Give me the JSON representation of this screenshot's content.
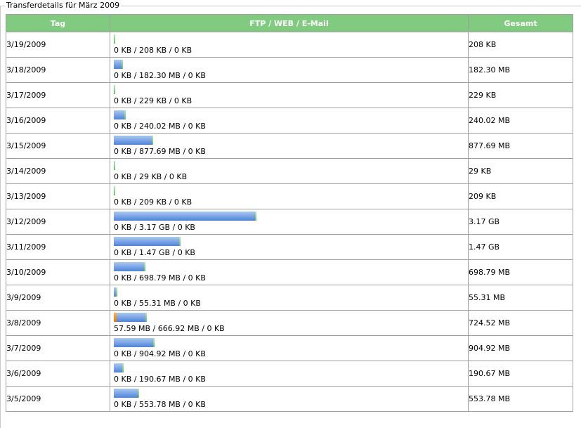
{
  "legend": "Transferdetails für März 2009",
  "headers": {
    "day": "Tag",
    "transfer": "FTP / WEB / E-Mail",
    "total": "Gesamt"
  },
  "colors": {
    "header_bg": "#81cb81",
    "ftp": "#f09a2a",
    "web": "#6b98e0",
    "mail": "#7fd07f"
  },
  "rows": [
    {
      "day": "3/19/2009",
      "detail": "0 KB / 208 KB / 0 KB",
      "total": "208 KB",
      "ftp_gb": 0,
      "web_gb": 0.0002
    },
    {
      "day": "3/18/2009",
      "detail": "0 KB / 182.30 MB / 0 KB",
      "total": "182.30 MB",
      "ftp_gb": 0,
      "web_gb": 0.178
    },
    {
      "day": "3/17/2009",
      "detail": "0 KB / 229 KB / 0 KB",
      "total": "229 KB",
      "ftp_gb": 0,
      "web_gb": 0.0002
    },
    {
      "day": "3/16/2009",
      "detail": "0 KB / 240.02 MB / 0 KB",
      "total": "240.02 MB",
      "ftp_gb": 0,
      "web_gb": 0.2344
    },
    {
      "day": "3/15/2009",
      "detail": "0 KB / 877.69 MB / 0 KB",
      "total": "877.69 MB",
      "ftp_gb": 0,
      "web_gb": 0.8571
    },
    {
      "day": "3/14/2009",
      "detail": "0 KB / 29 KB / 0 KB",
      "total": "29 KB",
      "ftp_gb": 0,
      "web_gb": 3e-05
    },
    {
      "day": "3/13/2009",
      "detail": "0 KB / 209 KB / 0 KB",
      "total": "209 KB",
      "ftp_gb": 0,
      "web_gb": 0.0002
    },
    {
      "day": "3/12/2009",
      "detail": "0 KB / 3.17 GB / 0 KB",
      "total": "3.17 GB",
      "ftp_gb": 0,
      "web_gb": 3.17
    },
    {
      "day": "3/11/2009",
      "detail": "0 KB / 1.47 GB / 0 KB",
      "total": "1.47 GB",
      "ftp_gb": 0,
      "web_gb": 1.47
    },
    {
      "day": "3/10/2009",
      "detail": "0 KB / 698.79 MB / 0 KB",
      "total": "698.79 MB",
      "ftp_gb": 0,
      "web_gb": 0.6824
    },
    {
      "day": "3/9/2009",
      "detail": "0 KB / 55.31 MB / 0 KB",
      "total": "55.31 MB",
      "ftp_gb": 0,
      "web_gb": 0.054
    },
    {
      "day": "3/8/2009",
      "detail": "57.59 MB / 666.92 MB / 0 KB",
      "total": "724.52 MB",
      "ftp_gb": 0.0562,
      "web_gb": 0.6513
    },
    {
      "day": "3/7/2009",
      "detail": "0 KB / 904.92 MB / 0 KB",
      "total": "904.92 MB",
      "ftp_gb": 0,
      "web_gb": 0.8837
    },
    {
      "day": "3/6/2009",
      "detail": "0 KB / 190.67 MB / 0 KB",
      "total": "190.67 MB",
      "ftp_gb": 0,
      "web_gb": 0.1862
    },
    {
      "day": "3/5/2009",
      "detail": "0 KB / 553.78 MB / 0 KB",
      "total": "553.78 MB",
      "ftp_gb": 0,
      "web_gb": 0.5408
    }
  ]
}
